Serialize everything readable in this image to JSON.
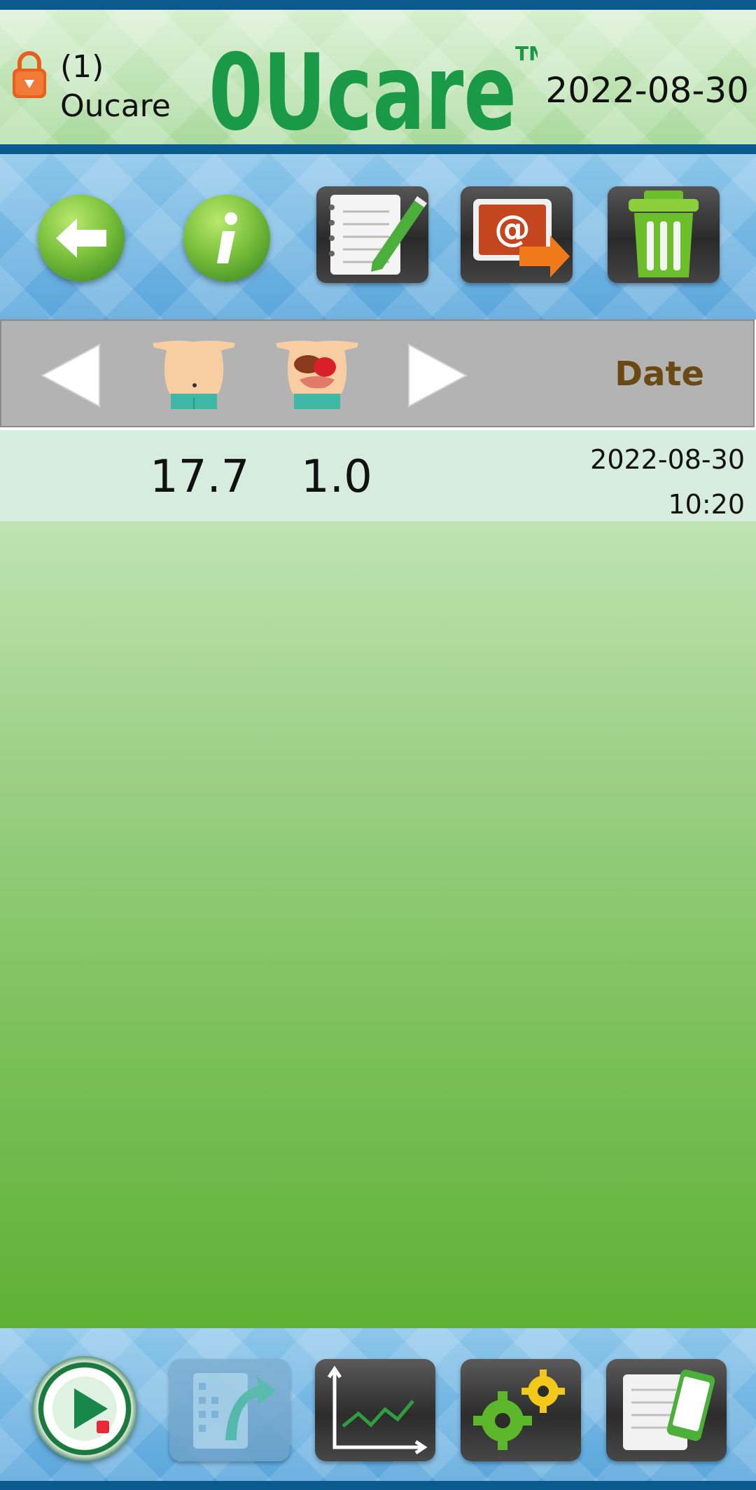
{
  "header": {
    "user_id": "(1)",
    "user_name": "Oucare",
    "logo_text": "0Ucare",
    "logo_tm": "TM",
    "date": "2022-08-30",
    "icons": {
      "lock": "lock-icon"
    }
  },
  "toolbar": {
    "buttons": [
      {
        "name": "back-button",
        "icon": "back-arrow-icon"
      },
      {
        "name": "info-button",
        "icon": "info-icon"
      },
      {
        "name": "notes-button",
        "icon": "notepad-pencil-icon"
      },
      {
        "name": "email-export-button",
        "icon": "email-export-icon"
      },
      {
        "name": "delete-button",
        "icon": "trash-icon"
      }
    ]
  },
  "columns": {
    "prev_icon": "left-triangle-icon",
    "col1_icon": "body-belly-icon",
    "col2_icon": "body-organs-icon",
    "next_icon": "right-triangle-icon",
    "date_label": "Date"
  },
  "records": [
    {
      "value1": "17.7",
      "value2": "1.0",
      "date": "2022-08-30",
      "time": "10:20"
    }
  ],
  "bottom_nav": {
    "items": [
      {
        "name": "start-measure-button",
        "icon": "play-icon"
      },
      {
        "name": "data-transfer-button",
        "icon": "transfer-icon",
        "disabled": true
      },
      {
        "name": "graph-button",
        "icon": "trend-graph-icon"
      },
      {
        "name": "settings-button",
        "icon": "gears-icon"
      },
      {
        "name": "device-records-button",
        "icon": "phone-document-icon"
      }
    ]
  },
  "colors": {
    "brand_green": "#1a9a47",
    "date_header": "#6a4a12",
    "bar_blue": "#0b5a8e"
  }
}
